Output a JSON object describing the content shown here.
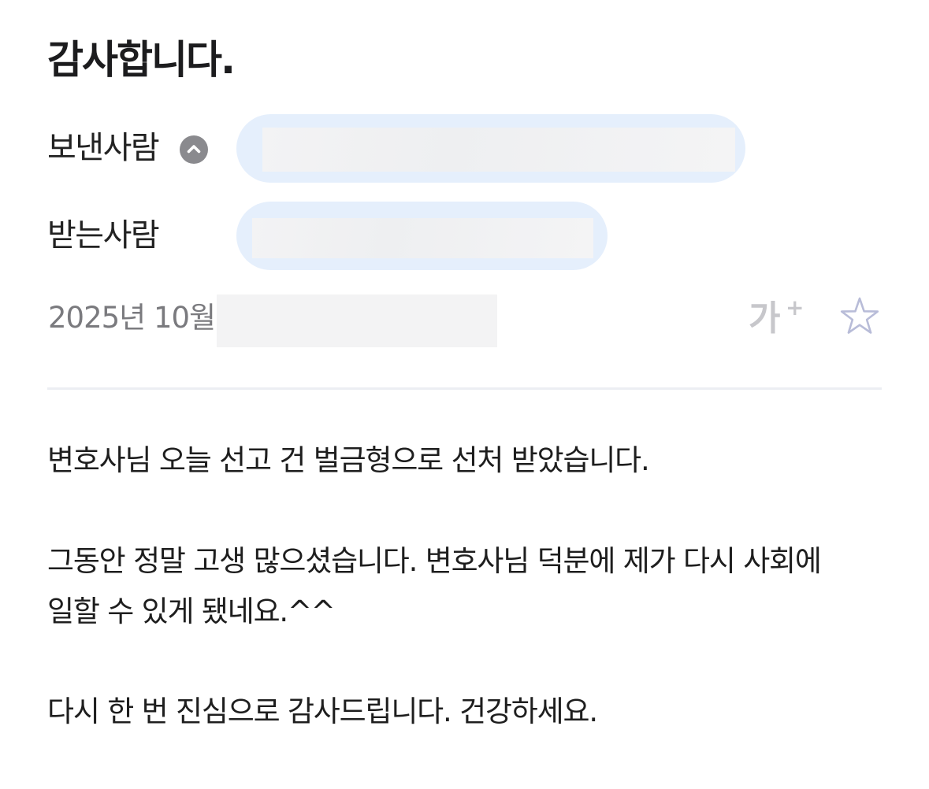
{
  "mail": {
    "subject": "감사합니다.",
    "sender_label": "보낸사람",
    "recipient_label": "받는사람",
    "date_prefix": "2025년 10월",
    "font_size_button_label": "가",
    "font_size_button_plus": "+",
    "icons": {
      "sender_toggle": "chevron-up-icon",
      "star": "star-outline-icon"
    },
    "colors": {
      "chip_background": "#e5effc",
      "toggle_background": "#8a8a8e",
      "star_stroke": "#b8bcd8"
    },
    "body_lines": [
      "변호사님 오늘 선고 건 벌금형으로 선처 받았습니다.",
      "그동안 정말 고생 많으셨습니다. 변호사님 덕분에 제가 다시 사회에",
      "일할 수 있게 됐네요.^^",
      "다시 한 번 진심으로 감사드립니다. 건강하세요."
    ]
  }
}
